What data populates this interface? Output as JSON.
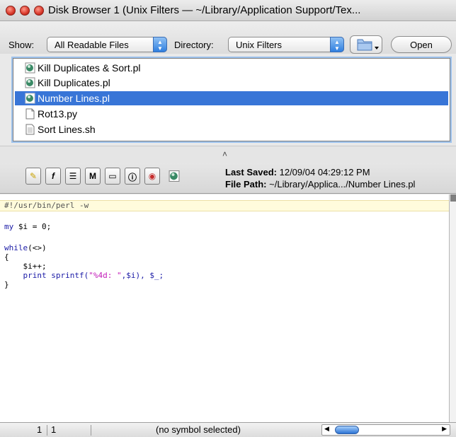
{
  "window": {
    "title": "Disk Browser 1 (Unix Filters — ~/Library/Application Support/Tex..."
  },
  "toolbar": {
    "show_label": "Show:",
    "show_value": "All Readable Files",
    "directory_label": "Directory:",
    "directory_value": "Unix Filters",
    "open_label": "Open"
  },
  "files": [
    {
      "name": "Kill Duplicates & Sort.pl",
      "icon": "perl-script-icon",
      "selected": false
    },
    {
      "name": "Kill Duplicates.pl",
      "icon": "perl-script-icon",
      "selected": false
    },
    {
      "name": "Number Lines.pl",
      "icon": "perl-script-icon",
      "selected": true
    },
    {
      "name": "Rot13.py",
      "icon": "document-icon",
      "selected": false
    },
    {
      "name": "Sort Lines.sh",
      "icon": "text-document-icon",
      "selected": false
    }
  ],
  "info": {
    "last_saved_label": "Last Saved:",
    "last_saved_value": "12/09/04 04:29:12 PM",
    "file_path_label": "File Path:",
    "file_path_value": "~/Library/Applica.../Number Lines.pl"
  },
  "code": {
    "l1": "#!/usr/bin/perl -w",
    "l2a": "my",
    "l2b": " $i = 0;",
    "l3a": "while",
    "l3b": "(<>)",
    "l4": "{",
    "l5": "    $i++;",
    "l6a": "    print sprintf(",
    "l6b": "\"%4d: \"",
    "l6c": ",$i), $_;",
    "l7": "}"
  },
  "status": {
    "line": "1",
    "column": "1",
    "symbol": "(no symbol selected)"
  },
  "colors": {
    "selection": "#3875d7",
    "current_line_highlight": "#fffbdc",
    "keyword": "#1a1aa6",
    "string": "#c21bb8"
  }
}
